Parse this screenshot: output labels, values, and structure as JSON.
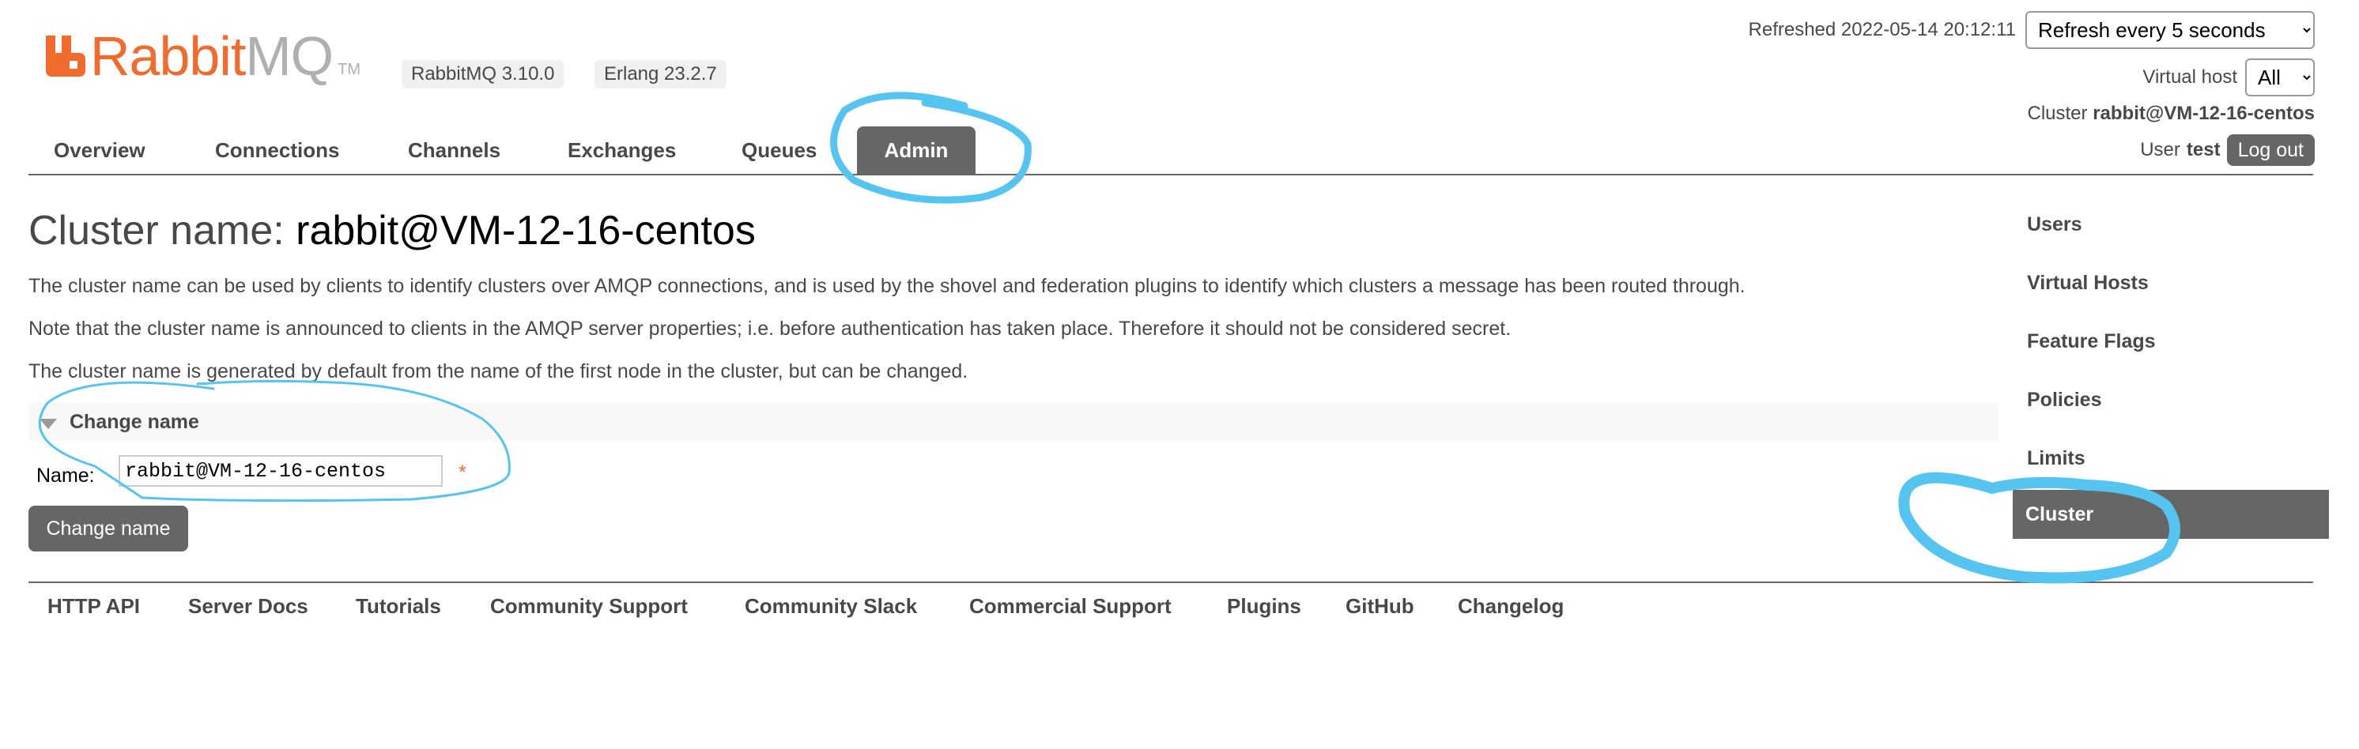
{
  "header": {
    "logo_rabbit": "Rabbit",
    "logo_mq": "MQ",
    "logo_tm": "TM",
    "rabbitmq_version": "RabbitMQ 3.10.0",
    "erlang_version": "Erlang 23.2.7",
    "refreshed_label": "Refreshed 2022-05-14 20:12:11",
    "refresh_select": "Refresh every 5 seconds",
    "vhost_label": "Virtual host",
    "vhost_select": "All",
    "cluster_label": "Cluster",
    "cluster_value": "rabbit@VM-12-16-centos",
    "user_label": "User",
    "user_value": "test",
    "logout": "Log out"
  },
  "tabs": [
    "Overview",
    "Connections",
    "Channels",
    "Exchanges",
    "Queues",
    "Admin"
  ],
  "active_tab": "Admin",
  "main": {
    "title_prefix": "Cluster name:",
    "title_name": "rabbit@VM-12-16-centos",
    "para1": "The cluster name can be used by clients to identify clusters over AMQP connections, and is used by the shovel and federation plugins to identify which clusters a message has been routed through.",
    "para2": "Note that the cluster name is announced to clients in the AMQP server properties; i.e. before authentication has taken place. Therefore it should not be considered secret.",
    "para3": "The cluster name is generated by default from the name of the first node in the cluster, but can be changed.",
    "section_title": "Change name",
    "name_label": "Name:",
    "name_value": "rabbit@VM-12-16-centos",
    "required_mark": "*",
    "submit": "Change name"
  },
  "sidebar": [
    "Users",
    "Virtual Hosts",
    "Feature Flags",
    "Policies",
    "Limits",
    "Cluster"
  ],
  "active_sidebar": "Cluster",
  "footer": [
    "HTTP API",
    "Server Docs",
    "Tutorials",
    "Community Support",
    "Community Slack",
    "Commercial Support",
    "Plugins",
    "GitHub",
    "Changelog"
  ],
  "colors": {
    "brand_orange": "#f26b2c",
    "active_gray": "#666666",
    "annotation_blue": "#55c4f0"
  }
}
